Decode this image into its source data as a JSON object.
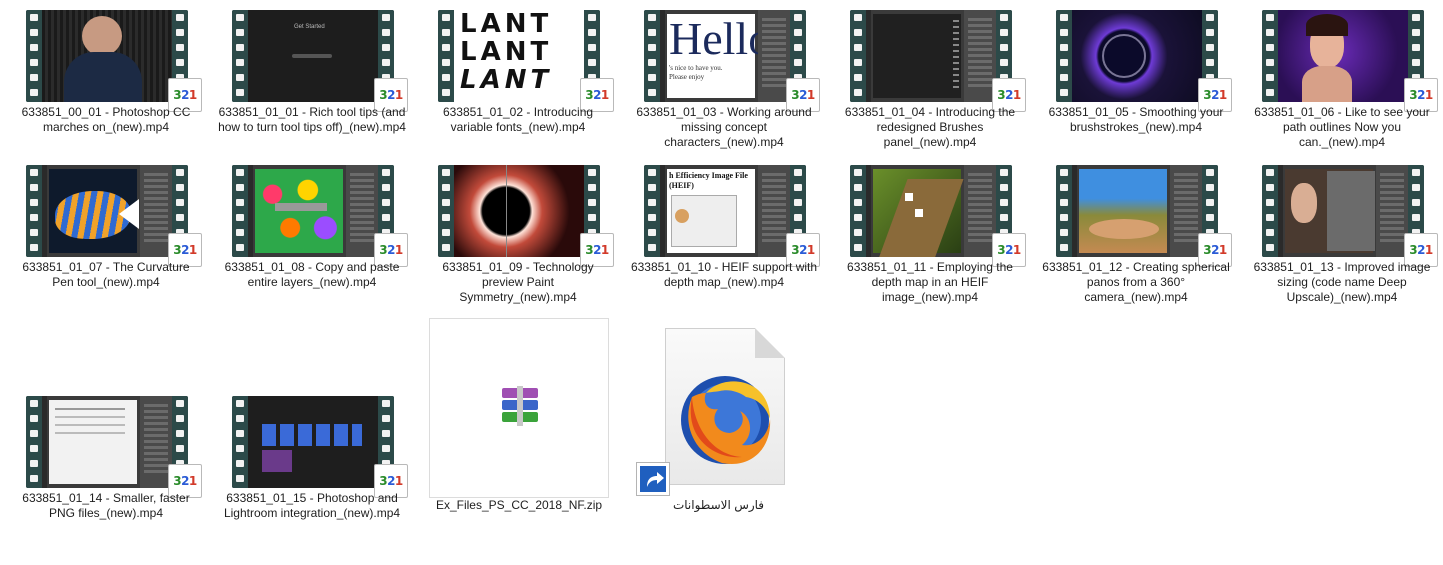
{
  "badge_text": "321",
  "files": [
    {
      "name": "633851_00_01 - Photoshop CC marches on_(new).mp4"
    },
    {
      "name": "633851_01_01 - Rich tool tips (and how to turn tool tips off)_(new).mp4"
    },
    {
      "name": "633851_01_02 - Introducing variable fonts_(new).mp4"
    },
    {
      "name": "633851_01_03 - Working around missing concept characters_(new).mp4"
    },
    {
      "name": "633851_01_04 - Introducing the redesigned Brushes panel_(new).mp4"
    },
    {
      "name": "633851_01_05 - Smoothing your brushstrokes_(new).mp4"
    },
    {
      "name": "633851_01_06 - Like to see your path outlines Now you can._(new).mp4"
    },
    {
      "name": "633851_01_07 - The Curvature Pen tool_(new).mp4"
    },
    {
      "name": "633851_01_08 - Copy and paste entire layers_(new).mp4"
    },
    {
      "name": "633851_01_09 - Technology preview Paint Symmetry_(new).mp4"
    },
    {
      "name": "633851_01_10 - HEIF support with depth map_(new).mp4"
    },
    {
      "name": "633851_01_11 - Employing the depth map in an HEIF image_(new).mp4"
    },
    {
      "name": "633851_01_12 - Creating spherical panos from a 360° camera_(new).mp4"
    },
    {
      "name": "633851_01_13 - Improved image sizing (code name Deep Upscale)_(new).mp4"
    },
    {
      "name": "633851_01_14 - Smaller, faster PNG files_(new).mp4"
    },
    {
      "name": "633851_01_15 - Photoshop and Lightroom integration_(new).mp4"
    }
  ],
  "zip": {
    "name": "Ex_Files_PS_CC_2018_NF.zip",
    "icon": "winrar-archive-icon"
  },
  "shortcut": {
    "name": "فارس الاسطوانات",
    "icon": "firefox-shortcut-icon"
  },
  "thumb_text": {
    "lant": "LANT",
    "hello": "Hello",
    "hello_sub1": "'s nice to have you.",
    "hello_sub2": "Please enjoy",
    "heif": "h Efficiency Image File (HEIF)",
    "get_started": "Get Started"
  },
  "colors": {
    "film": "#2c4a49",
    "selection_border": "#dcdcdc",
    "text": "#1e1e1e"
  }
}
